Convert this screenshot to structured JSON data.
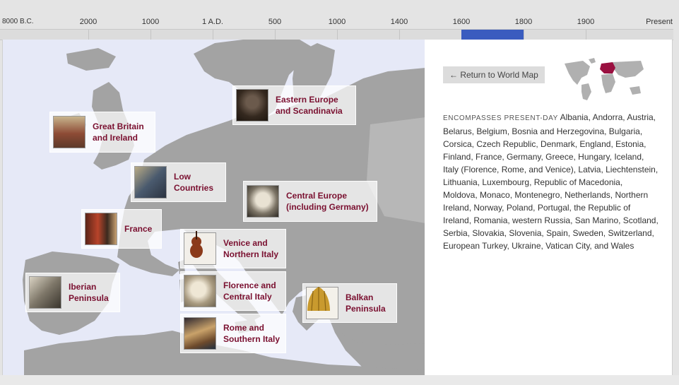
{
  "timeline": {
    "labels": [
      "8000 B.C.",
      "2000",
      "1000",
      "1 A.D.",
      "500",
      "1000",
      "1400",
      "1600",
      "1800",
      "1900",
      "Present"
    ],
    "selected_range": [
      "1600",
      "1800"
    ],
    "selected_color": "#3a5cbf"
  },
  "map": {
    "regions": [
      {
        "id": "great-britain",
        "label": "Great Britain\nand Ireland",
        "thumb_icon": "portrait-standing-figure"
      },
      {
        "id": "eastern-europe",
        "label": "Eastern Europe\nand Scandinavia",
        "thumb_icon": "bust-portrait"
      },
      {
        "id": "low-countries",
        "label": "Low\nCountries",
        "thumb_icon": "genre-painting"
      },
      {
        "id": "central-europe",
        "label": "Central Europe\n(including Germany)",
        "thumb_icon": "marble-bust"
      },
      {
        "id": "france",
        "label": "France",
        "thumb_icon": "group-painting"
      },
      {
        "id": "venice",
        "label": "Venice and\nNorthern Italy",
        "thumb_icon": "violin"
      },
      {
        "id": "iberian",
        "label": "Iberian\nPeninsula",
        "thumb_icon": "etching"
      },
      {
        "id": "florence",
        "label": "Florence and\nCentral Italy",
        "thumb_icon": "sculpted-head"
      },
      {
        "id": "balkan",
        "label": "Balkan\nPeninsula",
        "thumb_icon": "golden-helmet"
      },
      {
        "id": "rome",
        "label": "Rome and\nSouthern Italy",
        "thumb_icon": "figure-painting"
      }
    ]
  },
  "info": {
    "return_label": "← Return to World Map",
    "encompasses_prefix": "ENCOMPASSES PRESENT-DAY",
    "encompasses_text": "Albania, Andorra, Austria, Belarus, Belgium, Bosnia and Herzegovina, Bulgaria, Corsica, Czech Republic, Denmark, England, Estonia, Finland, France, Germany, Greece, Hungary, Iceland, Italy (Florence, Rome, and Venice), Latvia, Liechtenstein, Lithuania, Luxembourg, Republic of Macedonia, Moldova, Monaco, Montenegro, Netherlands, Northern Ireland, Norway, Poland, Portugal, the Republic of Ireland, Romania, western Russia, San Marino, Scotland, Serbia, Slovakia, Slovenia, Spain, Sweden, Switzerland, European Turkey, Ukraine, Vatican City, and Wales",
    "highlight_color": "#9a1040"
  }
}
